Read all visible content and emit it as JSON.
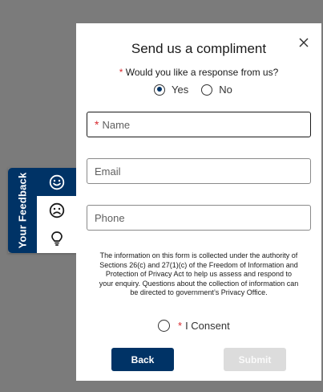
{
  "feedback_tab": {
    "label": "Your Feedback",
    "icons": [
      "smile-icon",
      "frown-icon",
      "lightbulb-icon"
    ],
    "active": "smile-icon"
  },
  "form": {
    "title": "Send us a compliment",
    "close_icon": "close-icon",
    "question_required_mark": "*",
    "question": "Would you like a response from us?",
    "options": [
      "Yes",
      "No"
    ],
    "selected_option": "Yes",
    "name": {
      "required_mark": "*",
      "placeholder": "Name",
      "value": ""
    },
    "email": {
      "placeholder": "Email",
      "value": ""
    },
    "phone": {
      "placeholder": "Phone",
      "value": ""
    },
    "disclaimer": "The information on this form is collected under the authority of Sections 26(c) and 27(1)(c) of the Freedom of Information and Protection of Privacy Act to help us assess and respond to your enquiry. Questions about the collection of information can be directed to government’s Privacy Office.",
    "consent_required_mark": "*",
    "consent_label": "I Consent",
    "back_label": "Back",
    "submit_label": "Submit"
  },
  "colors": {
    "brand_navy": "#003366",
    "required_red": "#d8292f",
    "backdrop": "#7b7b7b",
    "disabled": "#dcdcdc"
  }
}
